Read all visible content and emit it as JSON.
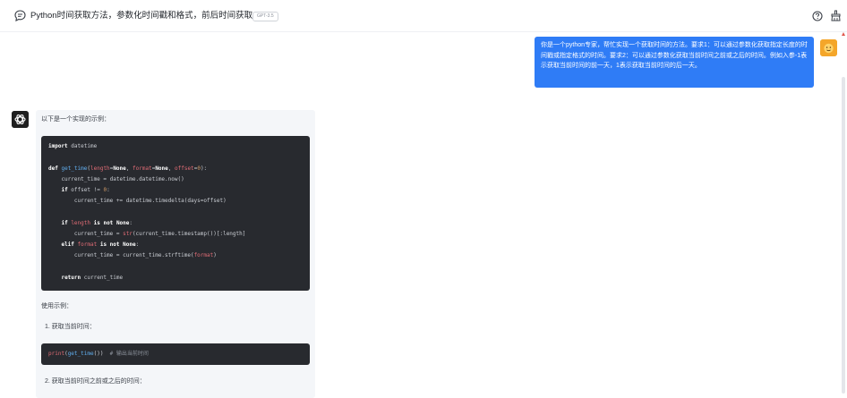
{
  "header": {
    "title": "Python时间获取方法，参数化时间戳和格式，前后时间获取",
    "model_badge": "GPT-3.5"
  },
  "user_message": {
    "text": "你是一个python专家，帮忙实现一个获取时间的方法。要求1：可以通过参数化获取指定长度的时间戳或指定格式的时间。要求2：可以通过参数化获取当前时间之前或之后的时间。例如入参-1表示获取当前时间的前一天，1表示获取当前时间的后一天。"
  },
  "bot_message": {
    "intro": "以下是一个实现的示例：",
    "code_main": [
      "import datetime",
      "",
      "def get_time(length=None, format=None, offset=0):",
      "    current_time = datetime.datetime.now()",
      "    if offset != 0:",
      "        current_time += datetime.timedelta(days=offset)",
      "",
      "    if length is not None:",
      "        current_time = str(current_time.timestamp())[:length]",
      "    elif format is not None:",
      "        current_time = current_time.strftime(format)",
      "",
      "    return current_time"
    ],
    "usage_heading": "使用示例：",
    "step1": "1. 获取当前时间：",
    "code_small": "print(get_time())  # 输出当前时间",
    "step2": "2. 获取当前时间之前或之后的时间："
  },
  "colors": {
    "user_bubble": "#2f7cf6",
    "code_background": "#282a2f",
    "card_background": "#f4f6f9"
  },
  "icons": {
    "title": "chat-bubble-icon",
    "help": "help-circle-icon",
    "clear": "broom-icon",
    "user_avatar": "user-avatar-icon",
    "bot_avatar": "chatgpt-logo-icon"
  }
}
